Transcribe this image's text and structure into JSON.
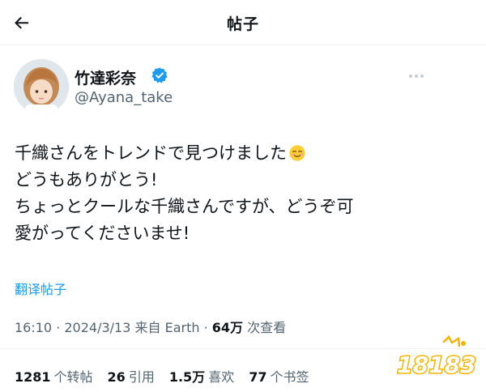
{
  "header": {
    "title": "帖子"
  },
  "author": {
    "name": "竹達彩奈",
    "handle": "@Ayana_take"
  },
  "post": {
    "lines": [
      "千織さんをトレンドで見つけました",
      "どうもありがとう!",
      "ちょっとクールな千織さんですが、どうぞ可",
      "愛がってくださいませ!"
    ],
    "emoji": "smiling-face-icon"
  },
  "translate_label": "翻译帖子",
  "meta": {
    "time": "16:10",
    "sep1": " · ",
    "date": "2024/3/13",
    "source": " 来自 Earth",
    "sep2": " · ",
    "views": "64万",
    "views_label": " 次查看"
  },
  "stats": {
    "reposts": "1281",
    "reposts_label": "个转帖",
    "quotes": "26",
    "quotes_label": "引用",
    "likes": "1.5万",
    "likes_label": "喜欢",
    "bookmarks": "77",
    "bookmarks_label": "个书签"
  },
  "watermark": {
    "text": "18183"
  },
  "colors": {
    "accent": "#1d9bf0",
    "text": "#0f1419",
    "muted": "#536471",
    "watermark": "#f5b400"
  }
}
